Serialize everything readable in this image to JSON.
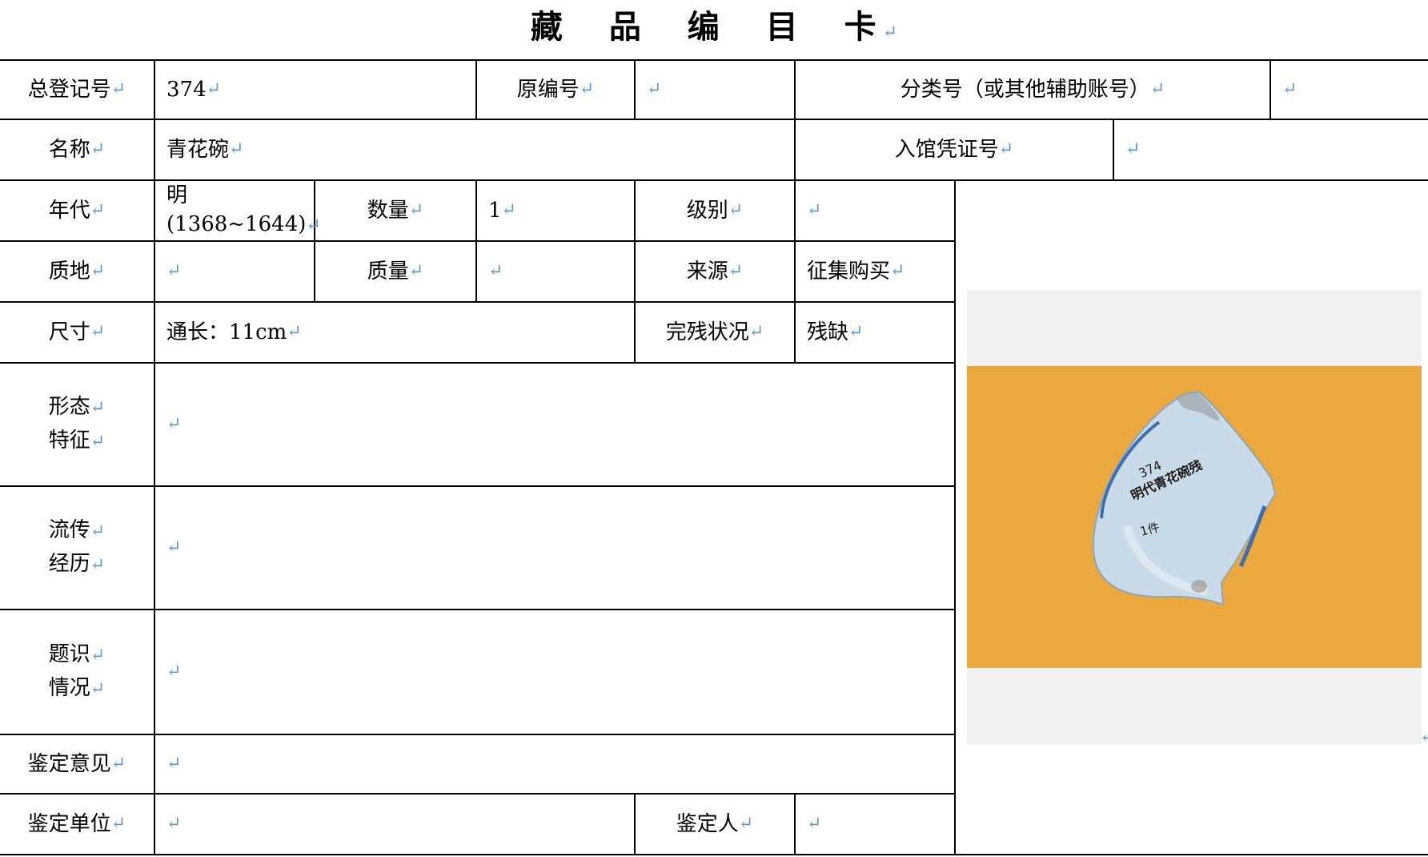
{
  "title": "藏 品 编 目 卡",
  "return_mark": "↵",
  "labels": {
    "total_reg_no": "总登记号",
    "original_no": "原编号",
    "classification_no": "分类号（或其他辅助账号）",
    "name": "名称",
    "entry_voucher_no": "入馆凭证号",
    "era": "年代",
    "quantity": "数量",
    "grade": "级别",
    "material": "质地",
    "mass": "质量",
    "source": "来源",
    "dimensions": "尺寸",
    "condition": "完残状况",
    "form_features_1": "形态",
    "form_features_2": "特征",
    "provenance_1": "流传",
    "provenance_2": "经历",
    "inscription_1": "题识",
    "inscription_2": "情况",
    "appraisal_opinion": "鉴定意见",
    "appraisal_unit": "鉴定单位",
    "appraiser": "鉴定人"
  },
  "values": {
    "total_reg_no": "374",
    "original_no": "",
    "classification_no": "",
    "name": "青花碗",
    "entry_voucher_no": "",
    "era_line1": "明",
    "era_line2": "(1368~1644)",
    "quantity": "1",
    "grade": "",
    "material": "",
    "mass": "",
    "source": "征集购买",
    "dimensions": "通长：11cm",
    "condition": "残缺",
    "form_features": "",
    "provenance": "",
    "inscription": "",
    "appraisal_opinion": "",
    "appraisal_unit": "",
    "appraiser": ""
  },
  "photo": {
    "marking_line1": "374",
    "marking_line2": "明代青花碗残",
    "marking_line3": "1件",
    "background_color": "#e8a53a",
    "porcelain_color": "#c9dbe8"
  }
}
